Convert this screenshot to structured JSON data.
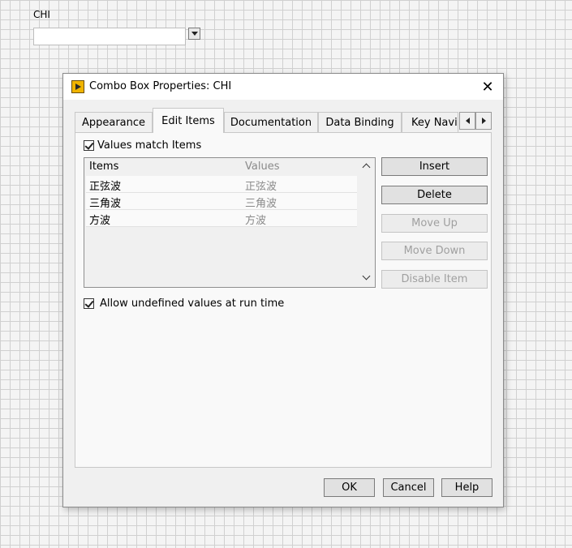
{
  "front_panel": {
    "label": "CHI"
  },
  "dialog": {
    "title": "Combo Box Properties: CHI",
    "close_glyph": "✕",
    "tabs": [
      {
        "label": "Appearance"
      },
      {
        "label": "Edit Items"
      },
      {
        "label": "Documentation"
      },
      {
        "label": "Data Binding"
      },
      {
        "label": "Key Navigation"
      }
    ],
    "active_tab": "Edit Items",
    "values_match_items": {
      "label": "Values match Items",
      "checked": true
    },
    "list": {
      "columns": {
        "items": "Items",
        "values": "Values"
      },
      "rows": [
        {
          "item": "正弦波",
          "value": "正弦波"
        },
        {
          "item": "三角波",
          "value": "三角波"
        },
        {
          "item": "方波",
          "value": "方波"
        }
      ]
    },
    "buttons": {
      "insert": "Insert",
      "delete": "Delete",
      "move_up": "Move Up",
      "move_down": "Move Down",
      "disable_item": "Disable Item"
    },
    "allow_undefined": {
      "label": "Allow undefined values at run time",
      "checked": true
    },
    "footer": {
      "ok": "OK",
      "cancel": "Cancel",
      "help": "Help"
    }
  },
  "icons": {
    "app": "labview-play-icon",
    "close": "close-icon",
    "dropdown": "dropdown-arrow-icon",
    "scroll_left": "scroll-left-icon",
    "scroll_right": "scroll-right-icon"
  },
  "colors": {
    "title_icon": "#f0b400",
    "disabled_text": "#a0a0a0",
    "value_text": "#8a8a8a"
  }
}
